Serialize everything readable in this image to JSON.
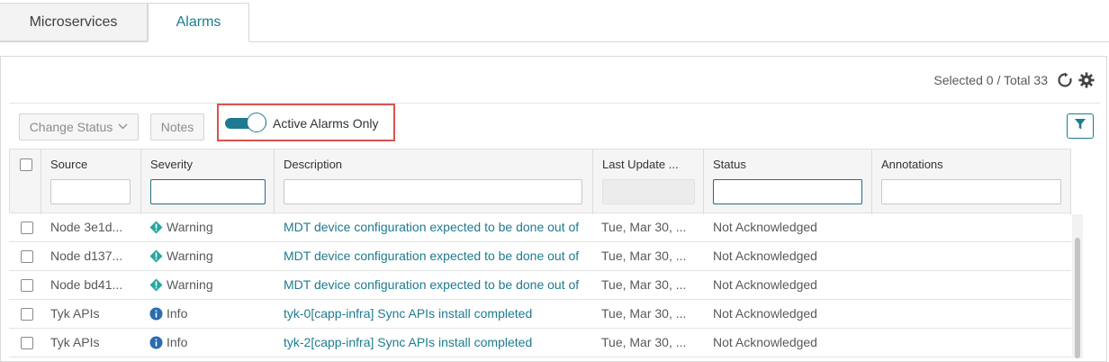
{
  "tabs": [
    {
      "label": "Microservices"
    },
    {
      "label": "Alarms"
    }
  ],
  "header": {
    "counts": "Selected 0 / Total 33"
  },
  "toolbar": {
    "change_status_label": "Change Status",
    "notes_label": "Notes",
    "active_alarms_label": "Active Alarms Only",
    "active_alarms_on": true
  },
  "columns": {
    "source": "Source",
    "severity": "Severity",
    "description": "Description",
    "last_update": "Last Update ...",
    "status": "Status",
    "annotations": "Annotations"
  },
  "rows": [
    {
      "source": "Node 3e1d...",
      "severity": "Warning",
      "description": "MDT device configuration expected to be done out of",
      "last_update": "Tue, Mar 30, ...",
      "status": "Not Acknowledged",
      "annotations": ""
    },
    {
      "source": "Node d137...",
      "severity": "Warning",
      "description": "MDT device configuration expected to be done out of",
      "last_update": "Tue, Mar 30, ...",
      "status": "Not Acknowledged",
      "annotations": ""
    },
    {
      "source": "Node bd41...",
      "severity": "Warning",
      "description": "MDT device configuration expected to be done out of",
      "last_update": "Tue, Mar 30, ...",
      "status": "Not Acknowledged",
      "annotations": ""
    },
    {
      "source": "Tyk APIs",
      "severity": "Info",
      "description": "tyk-0[capp-infra] Sync APIs install completed",
      "last_update": "Tue, Mar 30, ...",
      "status": "Not Acknowledged",
      "annotations": ""
    },
    {
      "source": "Tyk APIs",
      "severity": "Info",
      "description": "tyk-2[capp-infra] Sync APIs install completed",
      "last_update": "Tue, Mar 30, ...",
      "status": "Not Acknowledged",
      "annotations": ""
    }
  ],
  "icons": {
    "refresh": "refresh-icon",
    "settings": "gear-icon",
    "filter": "filter-icon",
    "warning": "warning-diamond-icon",
    "info": "info-circle-icon"
  },
  "colors": {
    "accent": "#1d7b8f",
    "warning": "#27a6a0",
    "info": "#2b6cb0",
    "highlight": "#d9534f"
  }
}
